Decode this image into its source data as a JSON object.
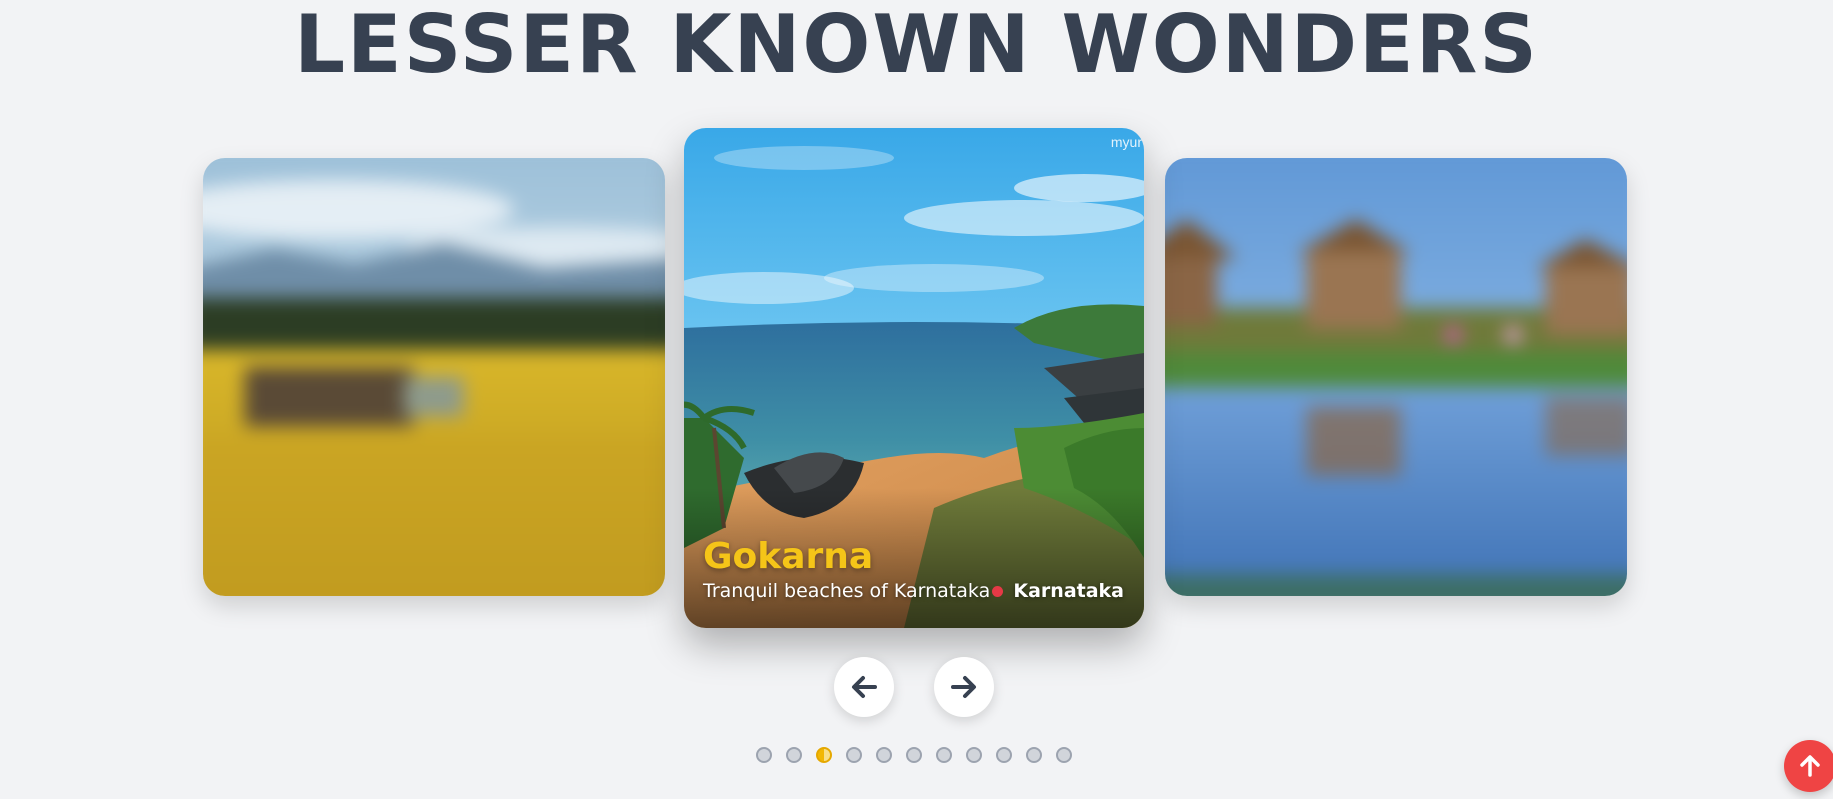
{
  "header": {
    "title": "LESSER KNOWN WONDERS"
  },
  "carousel": {
    "active_index": 2,
    "slide_count": 11,
    "active_slide": {
      "name": "Gokarna",
      "tagline": "Tranquil beaches of Karnataka",
      "region": "Karnataka",
      "watermark": "myur"
    },
    "prev_icon": "arrow-left-icon",
    "next_icon": "arrow-right-icon"
  },
  "colors": {
    "title": "#374151",
    "place_name": "#f5c518",
    "region_dot": "#e63946",
    "dot_active": "#f2b705",
    "scroll_top": "#ef4444"
  },
  "scroll_top": {
    "icon": "arrow-up-icon"
  }
}
